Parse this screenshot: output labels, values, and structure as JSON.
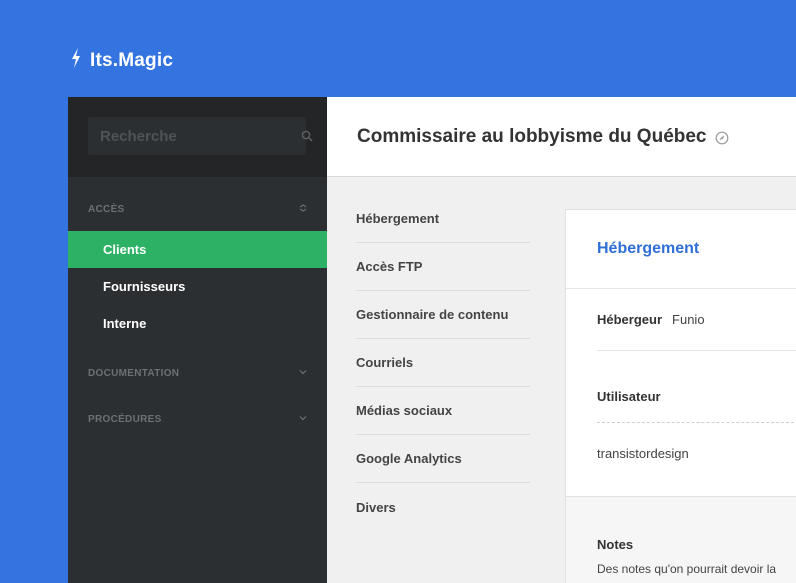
{
  "brand": {
    "name": "Its.Magic",
    "icon": "lightning-icon"
  },
  "search": {
    "placeholder": "Recherche",
    "icon": "search-icon"
  },
  "sidebar": {
    "sections": [
      {
        "title": "ACCÈS",
        "icon": "collapse-icon",
        "items": [
          "Clients",
          "Fournisseurs",
          "Interne"
        ],
        "active": "Clients"
      },
      {
        "title": "DOCUMENTATION",
        "icon": "chevron-down-icon"
      },
      {
        "title": "PROCÉDURES",
        "icon": "chevron-down-icon"
      }
    ]
  },
  "header": {
    "title": "Commissaire au lobbyisme du Québec",
    "icon": "compass-icon"
  },
  "subnav": {
    "items": [
      "Hébergement",
      "Accès FTP",
      "Gestionnaire de contenu",
      "Courriels",
      "Médias sociaux",
      "Google Analytics",
      "Divers"
    ]
  },
  "panel": {
    "title": "Hébergement",
    "host_label": "Hébergeur",
    "host_value": "Funio",
    "user_label": "Utilisateur",
    "user_value": "transistordesign",
    "notes_title": "Notes",
    "notes_text": "Des notes qu'on pourrait devoir la"
  },
  "colors": {
    "background": "#3474e0",
    "sidebar": "#2c2f32",
    "active": "#2db164",
    "accent_title": "#2f6fd6"
  }
}
